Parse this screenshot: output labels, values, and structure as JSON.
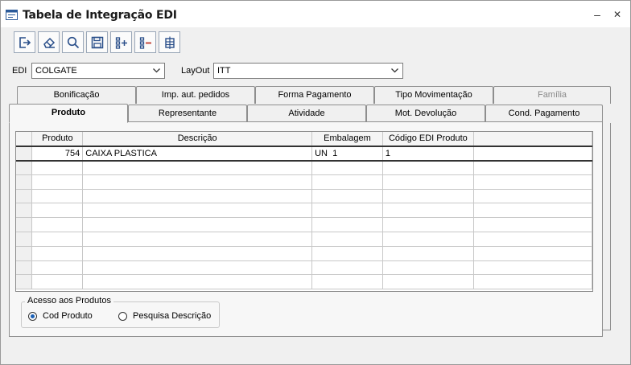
{
  "window": {
    "title": "Tabela de Integração EDI",
    "minimize_glyph": "–",
    "close_glyph": "✕"
  },
  "toolbar": {
    "buttons": [
      {
        "icon": "exit-icon"
      },
      {
        "icon": "eraser-icon"
      },
      {
        "icon": "search-icon"
      },
      {
        "icon": "save-icon"
      },
      {
        "icon": "add-row-icon"
      },
      {
        "icon": "remove-row-icon"
      },
      {
        "icon": "table-icon"
      }
    ]
  },
  "filters": {
    "edi_label": "EDI",
    "edi_value": "COLGATE",
    "layout_label": "LayOut",
    "layout_value": "ITT"
  },
  "tabs": {
    "row1": [
      "Bonificação",
      "Imp. aut. pedidos",
      "Forma Pagamento",
      "Tipo Movimentação",
      "Família"
    ],
    "row2": [
      "Produto",
      "Representante",
      "Atividade",
      "Mot. Devolução",
      "Cond. Pagamento"
    ],
    "active": "Produto"
  },
  "grid": {
    "columns": [
      "Produto",
      "Descrição",
      "Embalagem",
      "Código EDI Produto"
    ],
    "rows": [
      {
        "produto": "754",
        "descricao": "CAIXA PLASTICA",
        "embalagem": "UN  1",
        "codigo_edi": "1"
      }
    ]
  },
  "access": {
    "legend": "Acesso aos Produtos",
    "options": [
      "Cod Produto",
      "Pesquisa Descrição"
    ],
    "selected": "Cod Produto"
  },
  "colors": {
    "accent": "#1a5fb4",
    "border": "#8e8e8e",
    "titlebar": "#ffffff"
  }
}
